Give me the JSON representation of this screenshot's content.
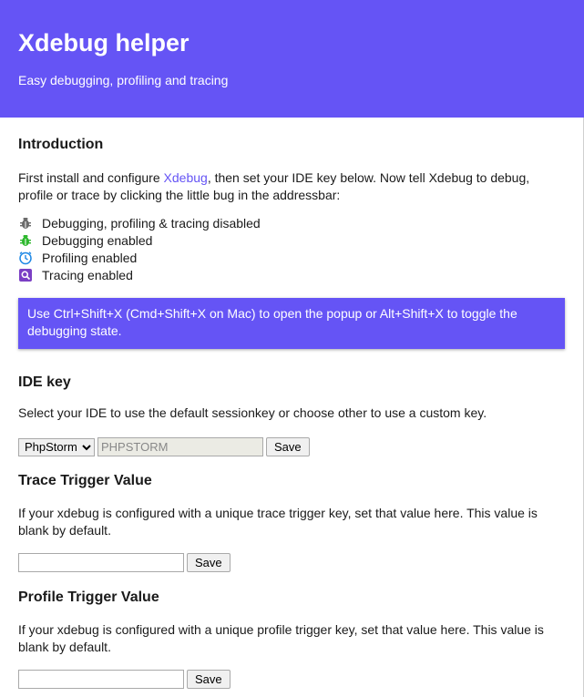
{
  "header": {
    "title": "Xdebug helper",
    "subtitle": "Easy debugging, profiling and tracing"
  },
  "colors": {
    "accent": "#6554f5",
    "disabled_icon": "#6b6b6b",
    "debug_icon": "#2eb82e",
    "profile_icon": "#1e88e5",
    "trace_icon": "#7b3fc4"
  },
  "intro": {
    "heading": "Introduction",
    "text_before_link": "First install and configure ",
    "link_text": "Xdebug",
    "text_after_link": ", then set your IDE key below. Now tell Xdebug to debug, profile or trace by clicking the little bug in the addressbar:",
    "states": [
      {
        "icon": "bug-disabled-icon",
        "label": "Debugging, profiling & tracing disabled"
      },
      {
        "icon": "bug-enabled-icon",
        "label": "Debugging enabled"
      },
      {
        "icon": "clock-icon",
        "label": "Profiling enabled"
      },
      {
        "icon": "trace-magnifier-icon",
        "label": "Tracing enabled"
      }
    ],
    "tip": "Use Ctrl+Shift+X (Cmd+Shift+X on Mac) to open the popup or Alt+Shift+X to toggle the debugging state."
  },
  "ide": {
    "heading": "IDE key",
    "description": "Select your IDE to use the default sessionkey or choose other to use a custom key.",
    "selected_ide": "PhpStorm",
    "key_value": "PHPSTORM",
    "save_label": "Save"
  },
  "trace": {
    "heading": "Trace Trigger Value",
    "description": "If your xdebug is configured with a unique trace trigger key, set that value here. This value is blank by default.",
    "value": "",
    "save_label": "Save"
  },
  "profile": {
    "heading": "Profile Trigger Value",
    "description": "If your xdebug is configured with a unique profile trigger key, set that value here. This value is blank by default.",
    "value": "",
    "save_label": "Save"
  }
}
